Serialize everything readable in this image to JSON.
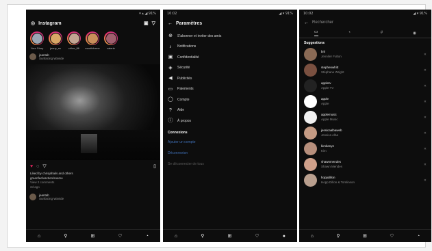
{
  "feed": {
    "status_time": "",
    "status_icons": "▾ ▴ ◢ 91%",
    "title": "Instagram",
    "stories": [
      {
        "name": "Your Story",
        "color": "#9aa7b3"
      },
      {
        "name": "jenny_ss",
        "color": "#d9a766"
      },
      {
        "name": "chloe_lilli",
        "color": "#c3a592"
      },
      {
        "name": "mouthforme",
        "color": "#c98e5a"
      },
      {
        "name": "valerie",
        "color": "#a05f6e"
      }
    ],
    "post_user": "jeantab",
    "post_location": "Sunfacing Wavide",
    "likes": "Liked by chrisjahalis and others",
    "caption": "greenfeelvaction/soeme",
    "comments": "View 2 comments",
    "time": "2d ago",
    "post2_user": "jeantab",
    "post2_location": "Sunfacing Wavide"
  },
  "settings": {
    "status_time": "10:02",
    "status_icons": "◢ ▾ 91%",
    "title": "Paramètres",
    "items": [
      {
        "icon": "follow-icon",
        "glyph": "⊕",
        "label": "S'abonner et inviter des amis"
      },
      {
        "icon": "bell-icon",
        "glyph": "♪",
        "label": "Notifications"
      },
      {
        "icon": "lock-icon",
        "glyph": "▣",
        "label": "Confidentialité"
      },
      {
        "icon": "shield-icon",
        "glyph": "◈",
        "label": "Sécurité"
      },
      {
        "icon": "megaphone-icon",
        "glyph": "◀",
        "label": "Publicités"
      },
      {
        "icon": "card-icon",
        "glyph": "▭",
        "label": "Paiements"
      },
      {
        "icon": "account-icon",
        "glyph": "◯",
        "label": "Compte"
      },
      {
        "icon": "help-icon",
        "glyph": "?",
        "label": "Aide"
      },
      {
        "icon": "info-icon",
        "glyph": "ⓘ",
        "label": "À propos"
      }
    ],
    "section": "Connexions",
    "link1": "Ajouter un compte",
    "link2": "Déconnexion",
    "link3": "Se déconnecter de tous"
  },
  "search": {
    "status_time": "10:02",
    "status_icons": "◢ ▾ 91%",
    "placeholder": "Rechercher",
    "section": "Suggestions",
    "accounts": [
      {
        "name": "brii",
        "desc": "Jennifer Fulton",
        "color": "#8a6a55"
      },
      {
        "name": "stephenwhitt",
        "desc": "Stéphane Wright",
        "color": "#7a5040"
      },
      {
        "name": "appletv",
        "desc": "Apple TV",
        "color": "#222222"
      },
      {
        "name": "apple",
        "desc": "Apple",
        "color": "#ffffff"
      },
      {
        "name": "applemusic",
        "desc": "Apple Music",
        "color": "#f0f0f0"
      },
      {
        "name": "jessicaalbaweb",
        "desc": "Jessica Alba",
        "color": "#c49a83"
      },
      {
        "name": "kimkanye",
        "desc": "Kim",
        "color": "#b78f7c"
      },
      {
        "name": "shawnmendes",
        "desc": "Shawn Mendes",
        "color": "#cfa08a"
      },
      {
        "name": "hoppdillon",
        "desc": "Hopp Dillon & Tomlinson",
        "color": "#b99f8e"
      }
    ]
  }
}
